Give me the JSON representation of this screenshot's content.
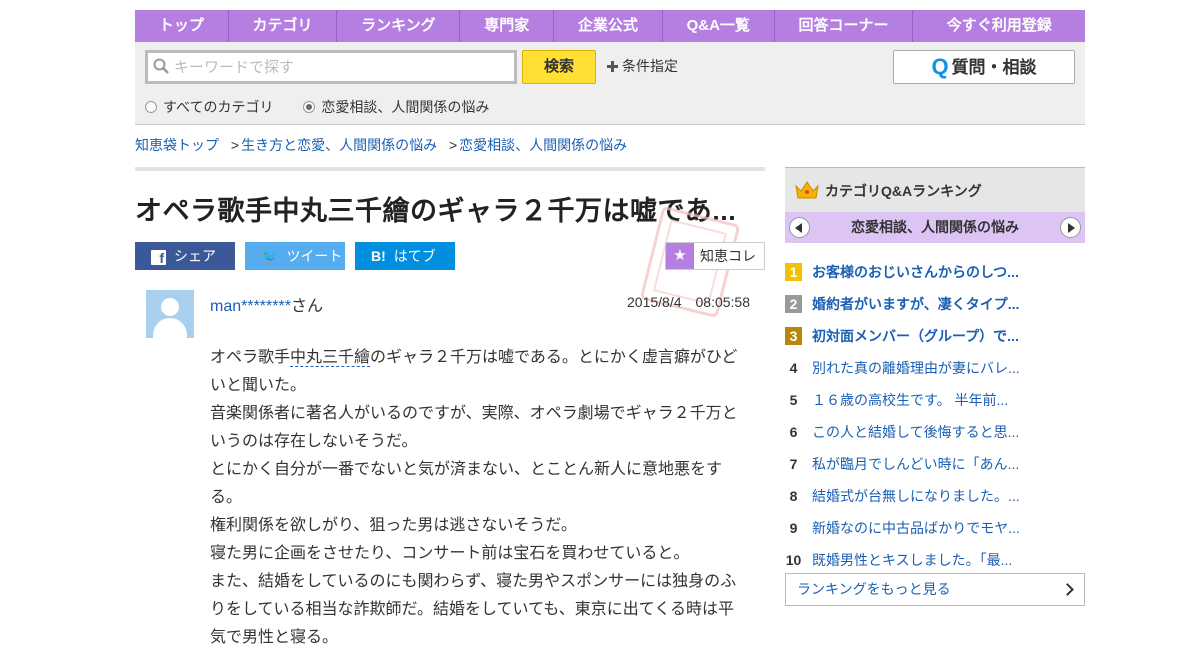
{
  "nav": [
    "トップ",
    "カテゴリ",
    "ランキング",
    "専門家",
    "企業公式",
    "Q&A一覧",
    "回答コーナー",
    "今すぐ利用登録"
  ],
  "search": {
    "placeholder": "キーワードで探す",
    "button": "検索",
    "conditions": "条件指定",
    "ask_button": "質問・相談",
    "ask_icon": "Q",
    "radio_all": "すべてのカテゴリ",
    "radio_cat": "恋愛相談、人間関係の悩み"
  },
  "breadcrumb": {
    "items": [
      "知恵袋トップ",
      "生き方と恋愛、人間関係の悩み",
      "恋愛相談、人間関係の悩み"
    ],
    "separator": ">"
  },
  "question": {
    "title": "オペラ歌手中丸三千繪のギャラ２千万は嘘であ...",
    "user": "man********",
    "honorific": "さん",
    "date": "2015/8/4　08:05:58",
    "lines": [
      [
        "オペラ歌手",
        "中丸三千繪",
        "のギャラ２千万は嘘である。とにかく虚言癖がひど"
      ],
      "いと聞いた。",
      "音楽関係者に著名人がいるのですが、実際、オペラ劇場でギャラ２千万と",
      "いうのは存在しないそうだ。",
      "とにかく自分が一番でないと気が済まない、とことん新人に意地悪をす",
      "る。",
      "権利関係を欲しがり、狙った男は逃さないそうだ。",
      "寝た男に企画をさせたり、コンサート前は宝石を買わせていると。",
      "また、結婚をしているのにも関わらず、寝た男やスポンサーには独身のふ",
      "りをしている相当な詐欺師だ。結婚をしていても、東京に出てくる時は平",
      "気で男性と寝る。"
    ]
  },
  "share": {
    "facebook": "シェア",
    "facebook_icon": "f",
    "twitter": "ツイート",
    "twitter_icon": "🐦",
    "hatena": "はてブ",
    "hatena_icon": "B!",
    "chiecolle": "知恵コレ",
    "chiecolle_icon": "★"
  },
  "ranking": {
    "title": "カテゴリQ&Aランキング",
    "category": "恋愛相談、人間関係の悩み",
    "items": [
      {
        "rank": "1",
        "text": "お客様のおじいさんからのしつ..."
      },
      {
        "rank": "2",
        "text": "婚約者がいますが、凄くタイプ..."
      },
      {
        "rank": "3",
        "text": "初対面メンバー（グループ）で..."
      },
      {
        "rank": "4",
        "text": "別れた真の離婚理由が妻にバレ..."
      },
      {
        "rank": "5",
        "text": "１６歳の高校生です。 半年前..."
      },
      {
        "rank": "6",
        "text": "この人と結婚して後悔すると思..."
      },
      {
        "rank": "7",
        "text": "私が臨月でしんどい時に「あん..."
      },
      {
        "rank": "8",
        "text": "結婚式が台無しになりました。..."
      },
      {
        "rank": "9",
        "text": "新婚なのに中古品ばかりでモヤ..."
      },
      {
        "rank": "10",
        "text": "既婚男性とキスしました。「最..."
      }
    ],
    "more": "ランキングをもっと見る"
  },
  "colors": {
    "nav_bg": "#b47fe0",
    "search_button": "#ffe033",
    "link": "#1a5fb4",
    "facebook": "#3b5998",
    "twitter": "#55acee",
    "hatena": "#008fde",
    "rank_gold": "#f2c200",
    "rank_silver": "#9a9a9a",
    "rank_bronze": "#b7860b"
  }
}
